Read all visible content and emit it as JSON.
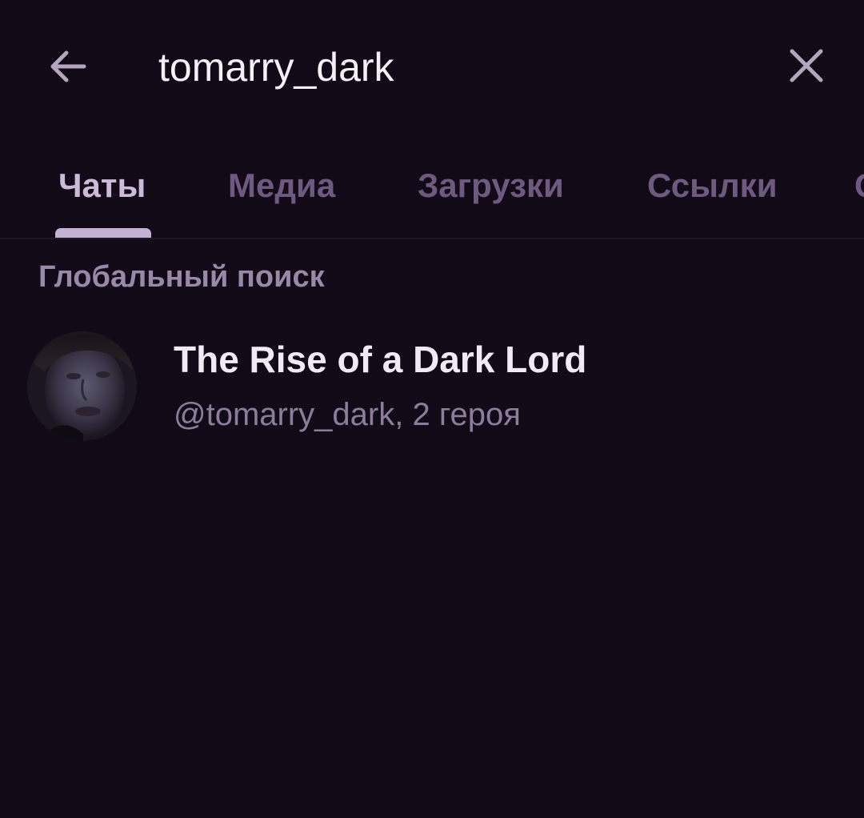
{
  "search": {
    "query": "tomarry_dark",
    "back_icon": "arrow-left-icon",
    "clear_icon": "close-icon"
  },
  "tabs": [
    {
      "label": "Чаты",
      "active": true
    },
    {
      "label": "Медиа",
      "active": false
    },
    {
      "label": "Загрузки",
      "active": false
    },
    {
      "label": "Ссылки",
      "active": false
    },
    {
      "label": "С",
      "active": false
    }
  ],
  "global_search": {
    "heading": "Глобальный поиск",
    "results": [
      {
        "title": "The Rise of a Dark Lord",
        "subtitle": "@tomarry_dark, 2 героя",
        "avatar": "user-photo-avatar"
      }
    ]
  },
  "colors": {
    "background": "#120a16",
    "accent": "#c4b2d4",
    "inactive_tab": "#6e5a80",
    "primary_text": "#f2eaf4",
    "secondary_text": "#8d7d9c"
  }
}
